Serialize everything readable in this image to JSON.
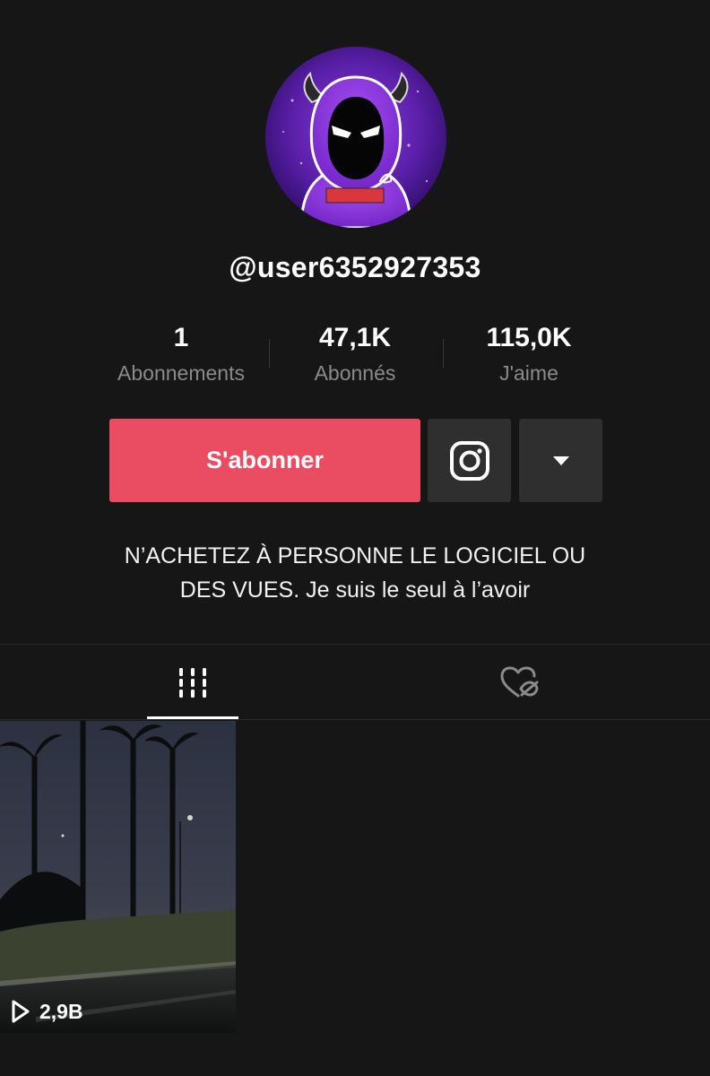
{
  "profile": {
    "username": "@user6352927353",
    "avatar_icon": "hooded-devil-avatar"
  },
  "stats": [
    {
      "value": "1",
      "label": "Abonnements"
    },
    {
      "value": "47,1K",
      "label": "Abonnés"
    },
    {
      "value": "115,0K",
      "label": "J'aime"
    }
  ],
  "actions": {
    "follow_label": "S'abonner",
    "instagram_icon": "instagram-icon",
    "more_icon": "caret-down-icon"
  },
  "bio": {
    "line1": "N’ACHETEZ À PERSONNE LE LOGICIEL OU",
    "line2": "DES VUES. Je suis le seul à l’avoir"
  },
  "tabs": [
    {
      "icon": "grid-icon",
      "active": true
    },
    {
      "icon": "liked-hidden-icon",
      "active": false
    }
  ],
  "videos": [
    {
      "views": "2,9B",
      "icon": "play-icon"
    }
  ],
  "colors": {
    "background": "#161616",
    "follow": "#ea4c61",
    "secondary_button": "#2f2f2f",
    "muted_text": "#8a8a8a"
  }
}
